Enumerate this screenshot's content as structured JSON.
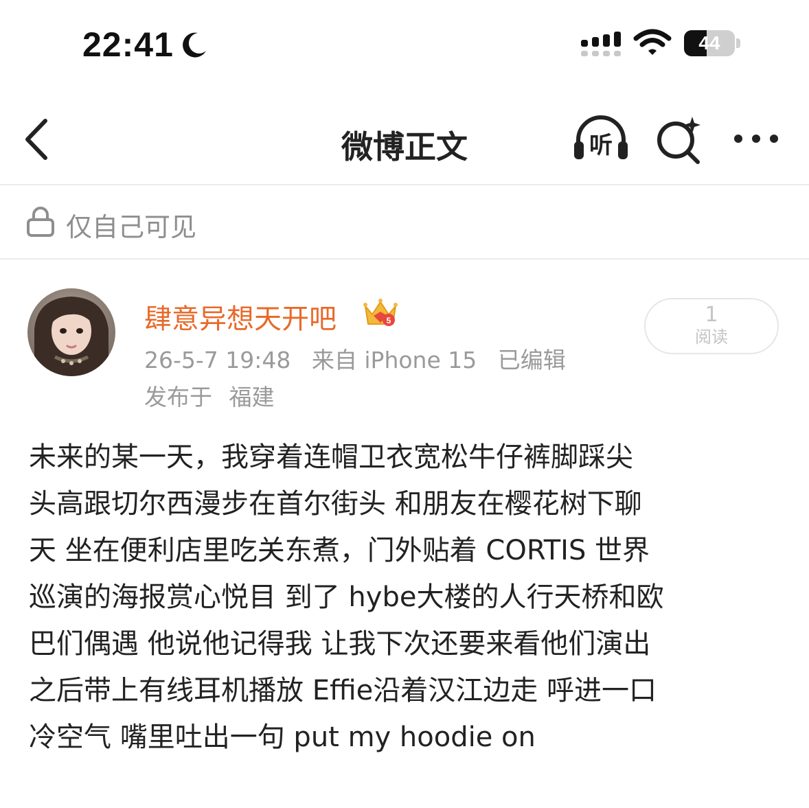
{
  "status_bar": {
    "time": "22:41",
    "battery_level": "44",
    "battery_fraction": 0.44
  },
  "nav": {
    "title": "微博正文",
    "listen_label": "听",
    "icons": [
      "back-arrow-icon",
      "listen-headphones-icon",
      "ai-search-icon",
      "more-icon"
    ]
  },
  "visibility": {
    "label": "仅自己可见"
  },
  "post": {
    "author": "肆意异想天开吧",
    "badge_icon": "crown-vip-icon",
    "date": "26-5-7 19:48",
    "source": "来自 iPhone 15",
    "edited": "已编辑",
    "location_prefix": "发布于",
    "location": "福建",
    "read_count": "1",
    "read_label": "阅读",
    "lines": [
      "未来的某一天，我穿着连帽卫衣宽松牛仔裤脚踩尖",
      "头高跟切尔西漫步在首尔街头 和朋友在樱花树下聊",
      "天 坐在便利店里吃关东煮，门外贴着 CORTIS 世界",
      "巡演的海报赏心悦目 到了 hybe大楼的人行天桥和欧",
      "巴们偶遇 他说他记得我 让我下次还要来看他们演出",
      "之后带上有线耳机播放 Effie沿着汉江边走 呼进一口",
      "冷空气 嘴里吐出一句 put my hoodie on"
    ]
  },
  "colors": {
    "username": "#e86a2a",
    "meta": "#9a9a9a",
    "text": "#222222"
  }
}
